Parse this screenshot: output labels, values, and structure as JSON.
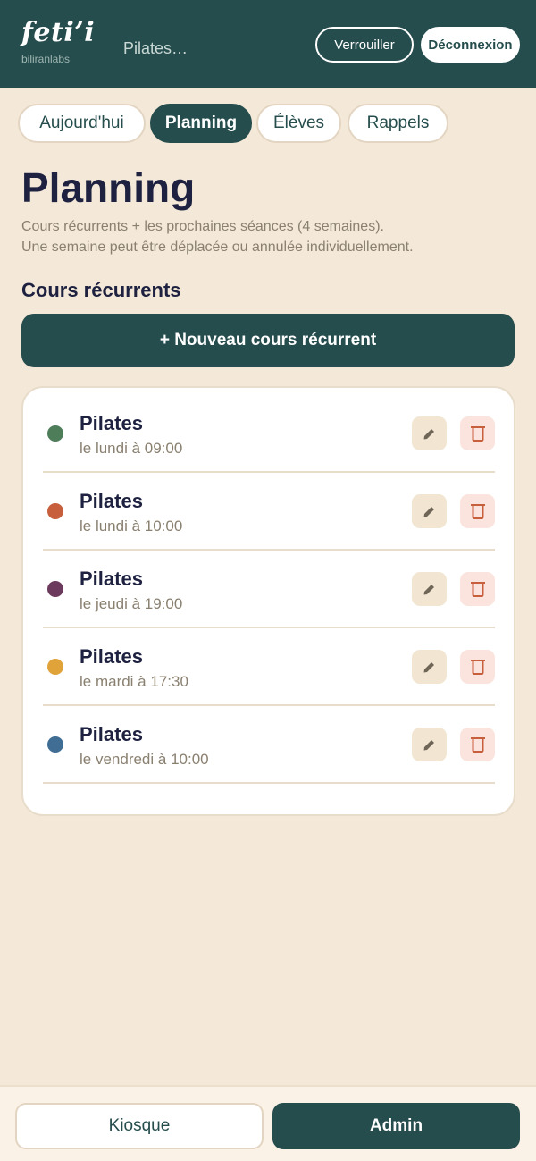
{
  "header": {
    "brand": "feti’i",
    "brand_sub": "biliranlabs",
    "context": "Pilates…",
    "lock_label": "Verrouiller",
    "logout_label": "Déconnexion"
  },
  "tabs": [
    {
      "label": "Aujourd'hui",
      "active": false
    },
    {
      "label": "Planning",
      "active": true
    },
    {
      "label": "Élèves",
      "active": false
    },
    {
      "label": "Rappels",
      "active": false
    }
  ],
  "page": {
    "title": "Planning",
    "desc_line1": "Cours récurrents + les prochaines séances (4 semaines).",
    "desc_line2": "Une semaine peut être déplacée ou annulée individuellement.",
    "section_title": "Cours récurrents",
    "new_button": "+ Nouveau cours récurrent"
  },
  "courses": [
    {
      "name": "Pilates",
      "schedule": "le lundi à 09:00",
      "color": "#4e7d5a",
      "edit_icon": "pencil-icon",
      "delete_icon": "trash-icon"
    },
    {
      "name": "Pilates",
      "schedule": "le lundi à 10:00",
      "color": "#c85f3c",
      "edit_icon": "pencil-icon",
      "delete_icon": "trash-icon"
    },
    {
      "name": "Pilates",
      "schedule": "le jeudi à 19:00",
      "color": "#6b3a5c",
      "edit_icon": "pencil-icon",
      "delete_icon": "trash-icon"
    },
    {
      "name": "Pilates",
      "schedule": "le mardi à 17:30",
      "color": "#e0a33a",
      "edit_icon": "pencil-icon",
      "delete_icon": "trash-icon"
    },
    {
      "name": "Pilates",
      "schedule": "le vendredi à 10:00",
      "color": "#3f6d94",
      "edit_icon": "pencil-icon",
      "delete_icon": "trash-icon"
    }
  ],
  "footer": {
    "kiosk_label": "Kiosque",
    "admin_label": "Admin"
  },
  "colors": {
    "primary": "#264d4d",
    "background": "#f4e9d8",
    "danger": "#c85f3c"
  }
}
